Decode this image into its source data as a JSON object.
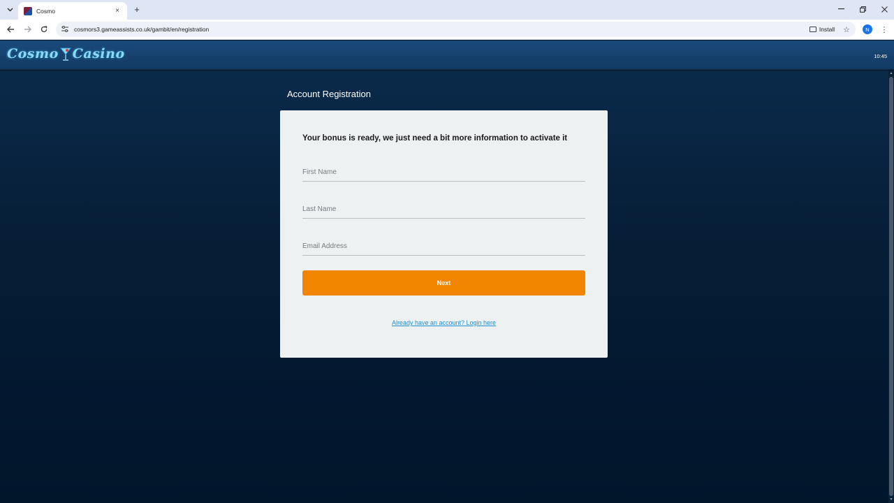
{
  "browser": {
    "tab_title": "Cosmo",
    "url": "cosmors3.gameassists.co.uk/gambit/en/registration",
    "install_label": "Install",
    "profile_initial": "N",
    "tab_list_icon": "chevron-down-icon",
    "new_tab_glyph": "+",
    "close_glyph": "×"
  },
  "header": {
    "logo_left": "Cosmo",
    "logo_right": "Casino",
    "clock": "10:45"
  },
  "page": {
    "title": "Account Registration"
  },
  "form": {
    "heading": "Your bonus is ready, we just need a bit more information to activate it",
    "first_name_placeholder": "First Name",
    "last_name_placeholder": "Last Name",
    "email_placeholder": "Email Address",
    "next_label": "Next",
    "login_link": "Already have an account? Login here"
  },
  "colors": {
    "accent": "#f28500",
    "link": "#1d8fd0",
    "header_bg": "#1b4a7a",
    "page_bg": "#01152b",
    "card_bg": "#eef1f2"
  }
}
